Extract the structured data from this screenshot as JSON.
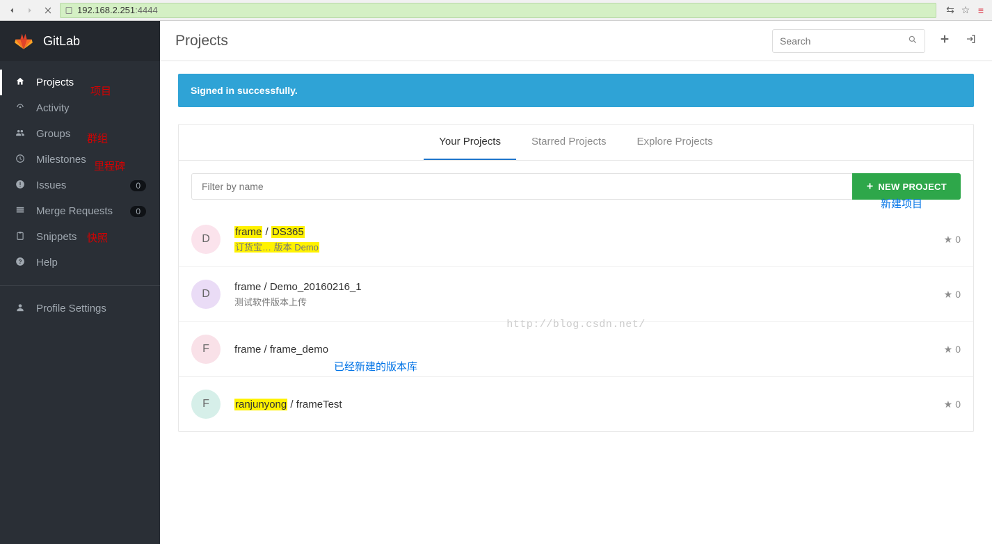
{
  "browser": {
    "url_host": "192.168.2.251",
    "url_port": ":4444"
  },
  "brand": "GitLab",
  "sidebar": {
    "items": [
      {
        "label": "Projects",
        "badge": null,
        "active": true
      },
      {
        "label": "Activity",
        "badge": null
      },
      {
        "label": "Groups",
        "badge": null
      },
      {
        "label": "Milestones",
        "badge": null
      },
      {
        "label": "Issues",
        "badge": "0"
      },
      {
        "label": "Merge Requests",
        "badge": "0"
      },
      {
        "label": "Snippets",
        "badge": null
      },
      {
        "label": "Help",
        "badge": null
      }
    ],
    "profile_label": "Profile Settings"
  },
  "annotations": {
    "sidebar_projects": "项目",
    "sidebar_groups": "群组",
    "sidebar_milestones": "里程碑",
    "sidebar_snippets": "快照",
    "new_project_hint": "新建项目",
    "repo_list_hint": "已经新建的版本库"
  },
  "topbar": {
    "title": "Projects",
    "search_placeholder": "Search"
  },
  "flash_message": "Signed in successfully.",
  "tabs": {
    "your": "Your Projects",
    "starred": "Starred Projects",
    "explore": "Explore Projects"
  },
  "filter": {
    "placeholder": "Filter by name",
    "new_button": "NEW PROJECT"
  },
  "projects": [
    {
      "avatar": "D",
      "avatar_class": "pink",
      "name_prefix_hl": "frame",
      "name_mid": " / ",
      "name_suffix_hl": "DS365",
      "desc_hl": "订货宝… 版本 Demo",
      "stars": "0"
    },
    {
      "avatar": "D",
      "avatar_class": "purple",
      "name": "frame / Demo_20160216_1",
      "desc": "测试软件版本上传",
      "stars": "0"
    },
    {
      "avatar": "F",
      "avatar_class": "pink2",
      "name": "frame / frame_demo",
      "desc": "",
      "stars": "0"
    },
    {
      "avatar": "F",
      "avatar_class": "teal",
      "name_prefix_hl": "ranjunyong",
      "name_mid": " / frameTest",
      "stars": "0"
    }
  ],
  "watermark": "http://blog.csdn.net/"
}
